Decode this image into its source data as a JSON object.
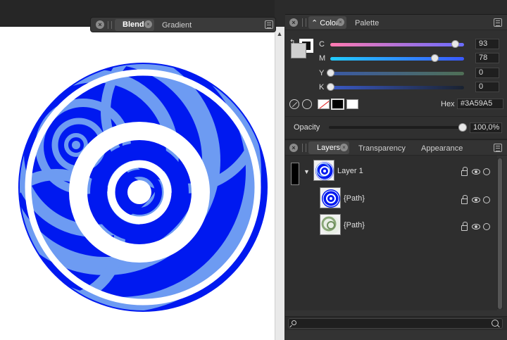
{
  "blend_panel": {
    "tab_active": "Blend",
    "tab_second": "Gradient"
  },
  "color_panel": {
    "tab_active": "Color",
    "tab_second": "Palette",
    "sliders": [
      {
        "channel": "C",
        "value": "93",
        "fraction": 0.93,
        "color_start": "#ff7ab0",
        "color_end": "#6a6cff"
      },
      {
        "channel": "M",
        "value": "78",
        "fraction": 0.78,
        "color_start": "#22ccff",
        "color_end": "#3a59ff"
      },
      {
        "channel": "Y",
        "value": "0",
        "fraction": 0.0,
        "color_start": "#3a59a5",
        "color_end": "#4f6f55"
      },
      {
        "channel": "K",
        "value": "0",
        "fraction": 0.0,
        "color_start": "#3a59c5",
        "color_end": "#1a2230"
      }
    ],
    "hex_label": "Hex",
    "hex_value": "#3A59A5",
    "opacity_label": "Opacity",
    "opacity_value": "100,0%"
  },
  "layers_panel": {
    "tabs": [
      "Layers",
      "Transparency",
      "Appearance"
    ],
    "layers": [
      {
        "name": "Layer 1"
      },
      {
        "name": "{Path}"
      },
      {
        "name": "{Path}"
      }
    ],
    "search_placeholder": ""
  },
  "artwork_colors": {
    "blue": "#0019f0",
    "light_blue": "#6d9bf2",
    "white": "#ffffff"
  }
}
